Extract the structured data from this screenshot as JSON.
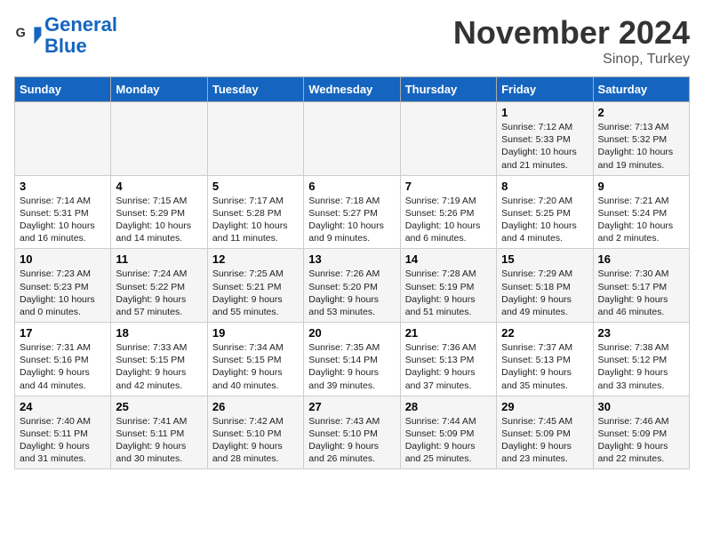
{
  "header": {
    "logo_line1": "General",
    "logo_line2": "Blue",
    "month": "November 2024",
    "location": "Sinop, Turkey"
  },
  "weekdays": [
    "Sunday",
    "Monday",
    "Tuesday",
    "Wednesday",
    "Thursday",
    "Friday",
    "Saturday"
  ],
  "weeks": [
    [
      {
        "day": "",
        "info": ""
      },
      {
        "day": "",
        "info": ""
      },
      {
        "day": "",
        "info": ""
      },
      {
        "day": "",
        "info": ""
      },
      {
        "day": "",
        "info": ""
      },
      {
        "day": "1",
        "info": "Sunrise: 7:12 AM\nSunset: 5:33 PM\nDaylight: 10 hours\nand 21 minutes."
      },
      {
        "day": "2",
        "info": "Sunrise: 7:13 AM\nSunset: 5:32 PM\nDaylight: 10 hours\nand 19 minutes."
      }
    ],
    [
      {
        "day": "3",
        "info": "Sunrise: 7:14 AM\nSunset: 5:31 PM\nDaylight: 10 hours\nand 16 minutes."
      },
      {
        "day": "4",
        "info": "Sunrise: 7:15 AM\nSunset: 5:29 PM\nDaylight: 10 hours\nand 14 minutes."
      },
      {
        "day": "5",
        "info": "Sunrise: 7:17 AM\nSunset: 5:28 PM\nDaylight: 10 hours\nand 11 minutes."
      },
      {
        "day": "6",
        "info": "Sunrise: 7:18 AM\nSunset: 5:27 PM\nDaylight: 10 hours\nand 9 minutes."
      },
      {
        "day": "7",
        "info": "Sunrise: 7:19 AM\nSunset: 5:26 PM\nDaylight: 10 hours\nand 6 minutes."
      },
      {
        "day": "8",
        "info": "Sunrise: 7:20 AM\nSunset: 5:25 PM\nDaylight: 10 hours\nand 4 minutes."
      },
      {
        "day": "9",
        "info": "Sunrise: 7:21 AM\nSunset: 5:24 PM\nDaylight: 10 hours\nand 2 minutes."
      }
    ],
    [
      {
        "day": "10",
        "info": "Sunrise: 7:23 AM\nSunset: 5:23 PM\nDaylight: 10 hours\nand 0 minutes."
      },
      {
        "day": "11",
        "info": "Sunrise: 7:24 AM\nSunset: 5:22 PM\nDaylight: 9 hours\nand 57 minutes."
      },
      {
        "day": "12",
        "info": "Sunrise: 7:25 AM\nSunset: 5:21 PM\nDaylight: 9 hours\nand 55 minutes."
      },
      {
        "day": "13",
        "info": "Sunrise: 7:26 AM\nSunset: 5:20 PM\nDaylight: 9 hours\nand 53 minutes."
      },
      {
        "day": "14",
        "info": "Sunrise: 7:28 AM\nSunset: 5:19 PM\nDaylight: 9 hours\nand 51 minutes."
      },
      {
        "day": "15",
        "info": "Sunrise: 7:29 AM\nSunset: 5:18 PM\nDaylight: 9 hours\nand 49 minutes."
      },
      {
        "day": "16",
        "info": "Sunrise: 7:30 AM\nSunset: 5:17 PM\nDaylight: 9 hours\nand 46 minutes."
      }
    ],
    [
      {
        "day": "17",
        "info": "Sunrise: 7:31 AM\nSunset: 5:16 PM\nDaylight: 9 hours\nand 44 minutes."
      },
      {
        "day": "18",
        "info": "Sunrise: 7:33 AM\nSunset: 5:15 PM\nDaylight: 9 hours\nand 42 minutes."
      },
      {
        "day": "19",
        "info": "Sunrise: 7:34 AM\nSunset: 5:15 PM\nDaylight: 9 hours\nand 40 minutes."
      },
      {
        "day": "20",
        "info": "Sunrise: 7:35 AM\nSunset: 5:14 PM\nDaylight: 9 hours\nand 39 minutes."
      },
      {
        "day": "21",
        "info": "Sunrise: 7:36 AM\nSunset: 5:13 PM\nDaylight: 9 hours\nand 37 minutes."
      },
      {
        "day": "22",
        "info": "Sunrise: 7:37 AM\nSunset: 5:13 PM\nDaylight: 9 hours\nand 35 minutes."
      },
      {
        "day": "23",
        "info": "Sunrise: 7:38 AM\nSunset: 5:12 PM\nDaylight: 9 hours\nand 33 minutes."
      }
    ],
    [
      {
        "day": "24",
        "info": "Sunrise: 7:40 AM\nSunset: 5:11 PM\nDaylight: 9 hours\nand 31 minutes."
      },
      {
        "day": "25",
        "info": "Sunrise: 7:41 AM\nSunset: 5:11 PM\nDaylight: 9 hours\nand 30 minutes."
      },
      {
        "day": "26",
        "info": "Sunrise: 7:42 AM\nSunset: 5:10 PM\nDaylight: 9 hours\nand 28 minutes."
      },
      {
        "day": "27",
        "info": "Sunrise: 7:43 AM\nSunset: 5:10 PM\nDaylight: 9 hours\nand 26 minutes."
      },
      {
        "day": "28",
        "info": "Sunrise: 7:44 AM\nSunset: 5:09 PM\nDaylight: 9 hours\nand 25 minutes."
      },
      {
        "day": "29",
        "info": "Sunrise: 7:45 AM\nSunset: 5:09 PM\nDaylight: 9 hours\nand 23 minutes."
      },
      {
        "day": "30",
        "info": "Sunrise: 7:46 AM\nSunset: 5:09 PM\nDaylight: 9 hours\nand 22 minutes."
      }
    ]
  ]
}
